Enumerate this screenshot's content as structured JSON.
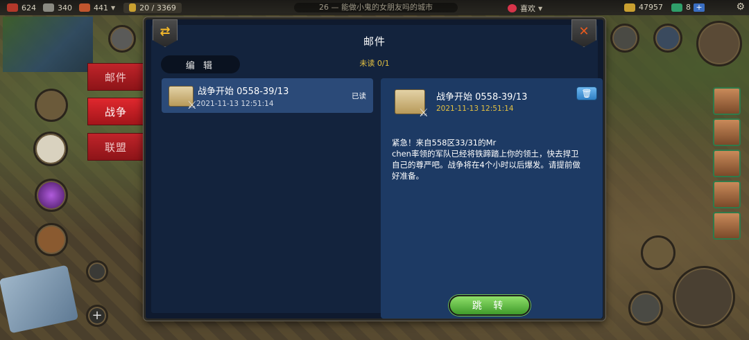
{
  "topbar": {
    "res1": "624",
    "res2": "340",
    "res3": "441",
    "population": "20 / 3369",
    "ticker": "能做小鬼的女朋友吗的城市",
    "ticker_level": "26",
    "favor": "喜欢",
    "gold": "47957",
    "gems": "8",
    "plus": "+"
  },
  "side_tabs": [
    {
      "label": "邮件",
      "active": false
    },
    {
      "label": "战争",
      "active": true
    },
    {
      "label": "联盟",
      "active": false
    }
  ],
  "panel": {
    "title": "邮件",
    "unread": "未读 0/1",
    "edit_label": "编 辑"
  },
  "mail_list": [
    {
      "title": "战争开始 0558-39/13",
      "time": "2021-11-13 12:51:14",
      "status": "已读"
    }
  ],
  "detail": {
    "title": "战争开始 0558-39/13",
    "time": "2021-11-13 12:51:14",
    "body": "紧急！来自558区33/31的Mr\nchen率领的军队已经将铁蹄踏上你的领土，快去捍卫自己的尊严吧。战争将在4个小时以后爆发。请提前做好准备。",
    "jump_label": "跳 转"
  },
  "colors": {
    "panel_bg": "#13233d",
    "selected_item": "#2b4a78",
    "accent_gold": "#e5c242",
    "tab_red": "#c0242a",
    "jump_green": "#5fb83c"
  }
}
